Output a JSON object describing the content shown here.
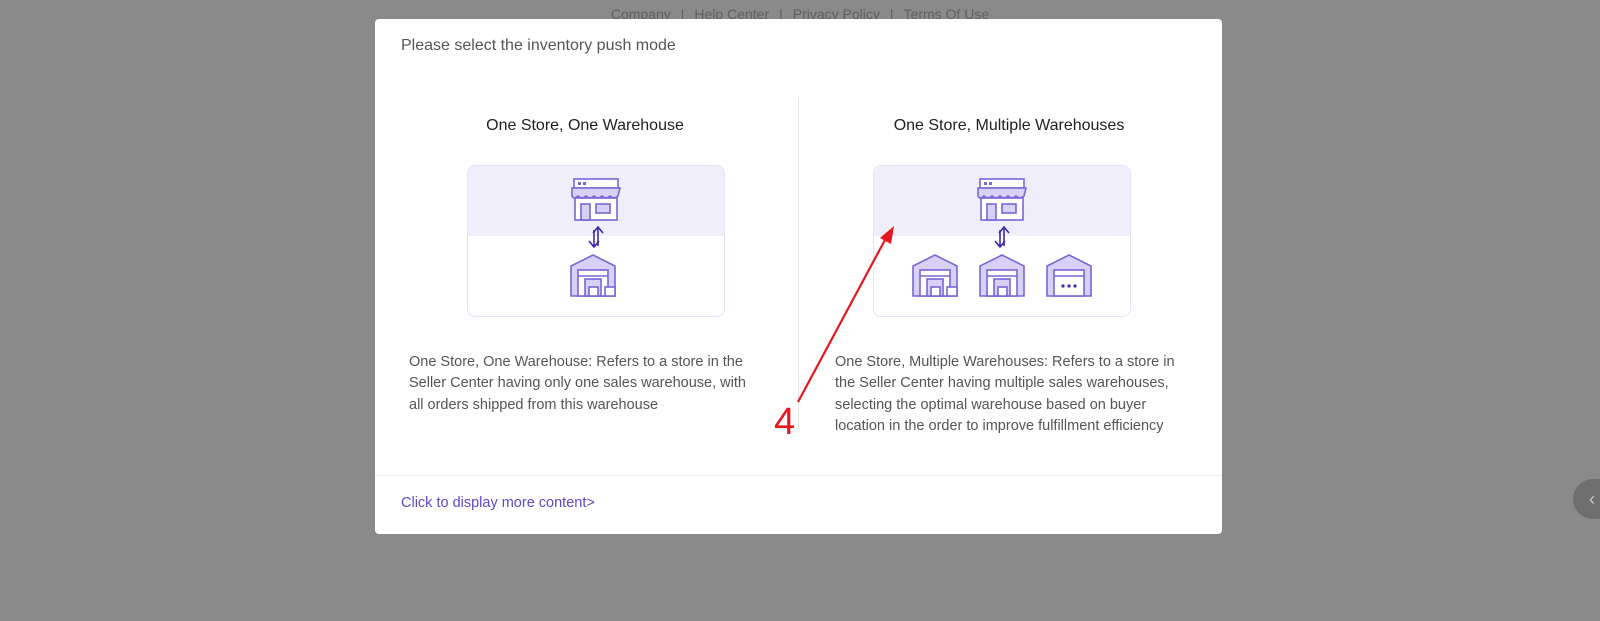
{
  "footer": {
    "links": [
      "Company",
      "Help Center",
      "Privacy Policy",
      "Terms Of Use"
    ]
  },
  "modal": {
    "title": "Please select the inventory push mode",
    "options": [
      {
        "heading": "One Store, One Warehouse",
        "description": "One Store, One Warehouse: Refers to a store in the Seller Center having only one sales warehouse, with all orders shipped from this warehouse"
      },
      {
        "heading": "One Store, Multiple Warehouses",
        "description": "One Store, Multiple Warehouses: Refers to a store in the Seller Center having multiple sales warehouses, selecting the optimal warehouse based on buyer location in the order to improve fulfillment efficiency"
      }
    ],
    "more_link": "Click to display more content>"
  },
  "annotation": {
    "number": "4"
  },
  "colors": {
    "accent": "#5b4bc8",
    "illustration": "#7a66d6",
    "annotation": "#e8171f"
  }
}
